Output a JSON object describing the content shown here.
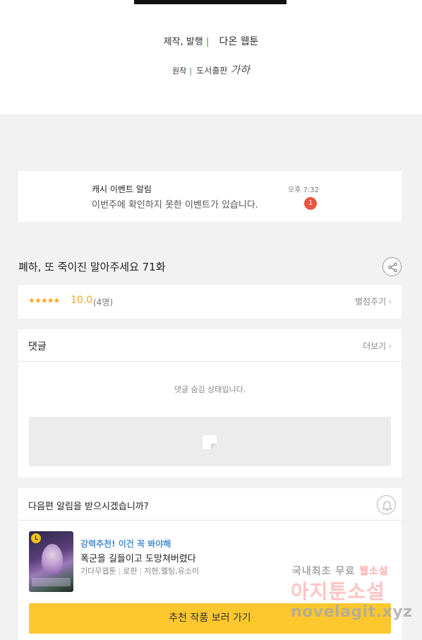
{
  "credits": {
    "production_label": "제작, 발행",
    "production_value": "다온 웹툰",
    "original_label": "원작",
    "original_value": "도서출판",
    "original_logo": "가하"
  },
  "cash_event": {
    "title": "캐시 이벤트 알림",
    "description": "이번주에 확인하지 못한 이벤트가 있습니다.",
    "time": "오후 7:32",
    "badge_count": "1"
  },
  "episode": {
    "title": "폐하, 또 죽이진 말아주세요 71화",
    "share_icon": "share-icon"
  },
  "rating": {
    "stars": "★★★★★",
    "score": "10.0",
    "count": "(4명)",
    "rate_button": "별점주기",
    "accent_color": "#f5a623"
  },
  "comments": {
    "title": "댓글",
    "more_label": "더보기",
    "hidden_message": "댓글 숨김 상태입니다."
  },
  "next_episode": {
    "question": "다음편 알림을 받으시겠습니까?",
    "bell_icon": "bell-icon"
  },
  "recommendation": {
    "tag": "강력추천! 이건 꼭 봐야해",
    "title": "폭군을 길들이고 도망쳐버렸다",
    "meta": [
      "기다무웹툰",
      "로판",
      "지현,멜팅,유소이"
    ],
    "button_label": "추천 작품 보러 가기",
    "button_color": "#fdc72e"
  },
  "watermark": {
    "line1_a": "국내최초 무료",
    "line1_b": "웹소설",
    "line2": "아지툰소설",
    "line3": "novelagit.xyz"
  }
}
